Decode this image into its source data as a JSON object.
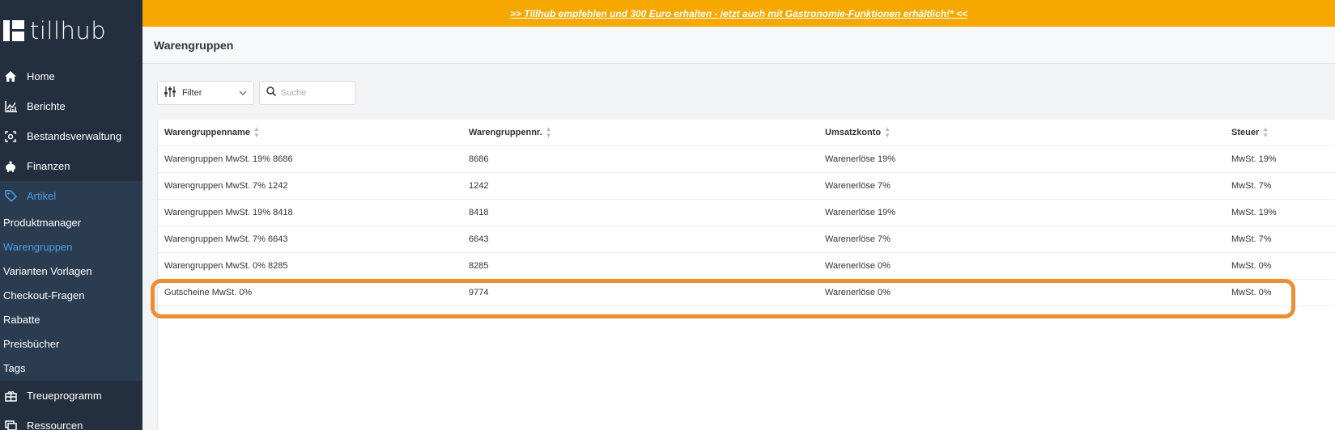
{
  "app": {
    "logo_text": "tillhub"
  },
  "banner": {
    "text": ">> Tillhub empfehlen und 300 Euro erhalten - jetzt auch mit Gastronomie-Funktionen erhältlich!* <<",
    "color": "#f6a800"
  },
  "sidebar": {
    "items": [
      {
        "label": "Home",
        "icon": "home-icon"
      },
      {
        "label": "Berichte",
        "icon": "chart-icon"
      },
      {
        "label": "Bestandsverwaltung",
        "icon": "inventory-icon"
      },
      {
        "label": "Finanzen",
        "icon": "piggy-bank-icon"
      },
      {
        "label": "Artikel",
        "icon": "tag-icon",
        "active": true
      }
    ],
    "sub_items": [
      {
        "label": "Produktmanager"
      },
      {
        "label": "Warengruppen",
        "active": true
      },
      {
        "label": "Varianten Vorlagen"
      },
      {
        "label": "Checkout-Fragen"
      },
      {
        "label": "Rabatte"
      },
      {
        "label": "Preisbücher"
      },
      {
        "label": "Tags"
      }
    ],
    "items_after": [
      {
        "label": "Treueprogramm",
        "icon": "gift-icon"
      },
      {
        "label": "Ressourcen",
        "icon": "resources-icon"
      }
    ]
  },
  "page": {
    "title": "Warengruppen"
  },
  "toolbar": {
    "filter_label": "Filter",
    "search_placeholder": "Suche"
  },
  "table": {
    "columns": [
      "Warengruppenname",
      "Warengruppennr.",
      "Umsatzkonto",
      "Steuer"
    ],
    "rows": [
      [
        "Warengruppen MwSt. 19% 8686",
        "8686",
        "Warenerlöse 19%",
        "MwSt. 19%"
      ],
      [
        "Warengruppen MwSt. 7% 1242",
        "1242",
        "Warenerlöse 7%",
        "MwSt. 7%"
      ],
      [
        "Warengruppen MwSt. 19% 8418",
        "8418",
        "Warenerlöse 19%",
        "MwSt. 19%"
      ],
      [
        "Warengruppen MwSt. 7% 6643",
        "6643",
        "Warenerlöse 7%",
        "MwSt. 7%"
      ],
      [
        "Warengruppen MwSt. 0% 8285",
        "8285",
        "Warenerlöse 0%",
        "MwSt. 0%"
      ],
      [
        "Gutscheine MwSt. 0%",
        "9774",
        "Warenerlöse 0%",
        "MwSt. 0%"
      ]
    ],
    "highlighted_row": 5,
    "highlight_color": "#ef8d33"
  }
}
